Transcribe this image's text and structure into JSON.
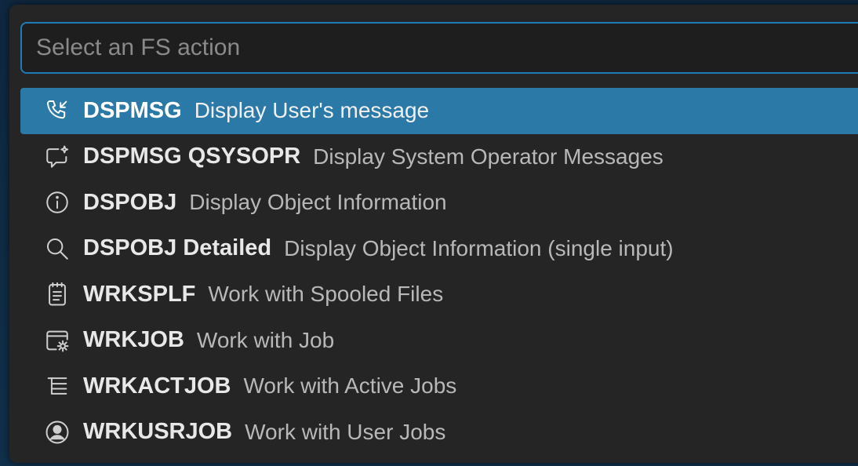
{
  "search": {
    "placeholder": "Select an FS action",
    "value": ""
  },
  "actions": [
    {
      "command": "DSPMSG",
      "description": "Display User's message",
      "icon": "call-incoming-icon",
      "selected": true
    },
    {
      "command": "DSPMSG QSYSOPR",
      "description": "Display System Operator Messages",
      "icon": "comment-sparkle-icon",
      "selected": false
    },
    {
      "command": "DSPOBJ",
      "description": "Display Object Information",
      "icon": "info-icon",
      "selected": false
    },
    {
      "command": "DSPOBJ Detailed",
      "description": "Display Object Information (single input)",
      "icon": "search-icon",
      "selected": false
    },
    {
      "command": "WRKSPLF",
      "description": "Work with Spooled Files",
      "icon": "notebook-icon",
      "selected": false
    },
    {
      "command": "WRKJOB",
      "description": "Work with Job",
      "icon": "window-gear-icon",
      "selected": false
    },
    {
      "command": "WRKACTJOB",
      "description": "Work with Active Jobs",
      "icon": "list-tree-icon",
      "selected": false
    },
    {
      "command": "WRKUSRJOB",
      "description": "Work with User Jobs",
      "icon": "account-icon",
      "selected": false
    }
  ],
  "colors": {
    "accent": "#2b79a6",
    "input_border": "#1f7ab7",
    "panel_bg": "#252526"
  }
}
